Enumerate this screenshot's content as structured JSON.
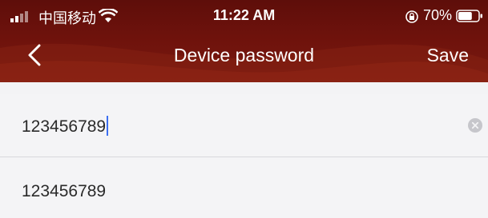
{
  "status_bar": {
    "carrier": "中国移动",
    "time": "11:22 AM",
    "battery_percent": "70%",
    "battery_level": 0.7,
    "icons": [
      "signal-icon",
      "wifi-icon",
      "rotation-lock-icon",
      "battery-icon"
    ]
  },
  "nav": {
    "title": "Device password",
    "save_label": "Save",
    "back_icon": "chevron-left-icon"
  },
  "form": {
    "password_input_value": "123456789",
    "confirm_value": "123456789",
    "clear_icon": "clear-icon"
  },
  "colors": {
    "header": "#6e120c",
    "caret": "#3d6ff0",
    "background": "#f3f3f5"
  }
}
